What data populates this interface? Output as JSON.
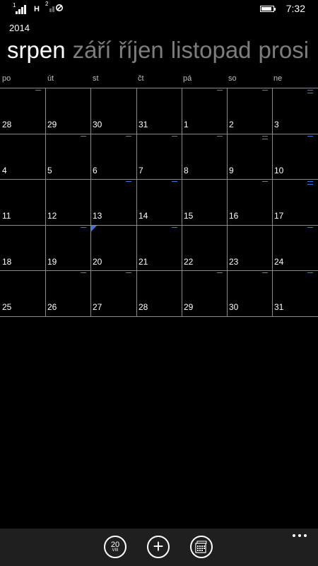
{
  "status": {
    "sim1_number": "1",
    "sim2_number": "2",
    "network_type": "H",
    "time": "7:32",
    "battery_level": 0.85,
    "sim1_signal_bars": 4,
    "sim2_state": "no-signal"
  },
  "calendar": {
    "year": "2014",
    "months": [
      "srpen",
      "září",
      "říjen",
      "listopad",
      "prosi"
    ],
    "weekdays": [
      "po",
      "út",
      "st",
      "čt",
      "pá",
      "so",
      "ne"
    ],
    "weeks": [
      [
        {
          "day": "28",
          "mark": "dim"
        },
        {
          "day": "29",
          "mark": ""
        },
        {
          "day": "30",
          "mark": ""
        },
        {
          "day": "31",
          "mark": ""
        },
        {
          "day": "1",
          "mark": "dim"
        },
        {
          "day": "2",
          "mark": "dim"
        },
        {
          "day": "3",
          "mark": "blue2"
        }
      ],
      [
        {
          "day": "4",
          "mark": ""
        },
        {
          "day": "5",
          "mark": "dim"
        },
        {
          "day": "6",
          "mark": "dim"
        },
        {
          "day": "7",
          "mark": "dim"
        },
        {
          "day": "8",
          "mark": "dim"
        },
        {
          "day": "9",
          "mark": "dim2"
        },
        {
          "day": "10",
          "mark": "blue"
        }
      ],
      [
        {
          "day": "11",
          "mark": ""
        },
        {
          "day": "12",
          "mark": ""
        },
        {
          "day": "13",
          "mark": "blue"
        },
        {
          "day": "14",
          "mark": "blue"
        },
        {
          "day": "15",
          "mark": ""
        },
        {
          "day": "16",
          "mark": "dim"
        },
        {
          "day": "17",
          "mark": "blue2"
        }
      ],
      [
        {
          "day": "18",
          "mark": ""
        },
        {
          "day": "19",
          "mark": "blue"
        },
        {
          "day": "20",
          "mark": "",
          "today": true
        },
        {
          "day": "21",
          "mark": "blue"
        },
        {
          "day": "22",
          "mark": ""
        },
        {
          "day": "23",
          "mark": ""
        },
        {
          "day": "24",
          "mark": "blue"
        }
      ],
      [
        {
          "day": "25",
          "mark": ""
        },
        {
          "day": "26",
          "mark": "dim"
        },
        {
          "day": "27",
          "mark": "dim"
        },
        {
          "day": "28",
          "mark": ""
        },
        {
          "day": "29",
          "mark": "dim"
        },
        {
          "day": "30",
          "mark": "dim"
        },
        {
          "day": "31",
          "mark": "blue"
        }
      ]
    ]
  },
  "appbar": {
    "today_day": "20",
    "today_month": "VIII",
    "add_glyph": "+",
    "more_dots": "..."
  },
  "colors": {
    "accent": "#3b73e8",
    "mark_dim": "#7a7a7a",
    "gridline": "#8a8a8a"
  }
}
